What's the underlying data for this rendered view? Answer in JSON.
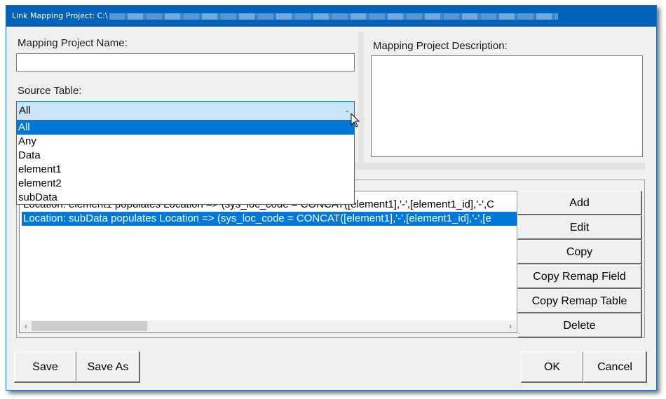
{
  "window": {
    "title": "Link Mapping Project: C:\\"
  },
  "form": {
    "project_name_label": "Mapping Project Name:",
    "project_name_value": "",
    "description_label": "Mapping Project Description:",
    "description_value": "",
    "source_table_label": "Source Table:",
    "source_table_selected": "All",
    "source_table_options": [
      "All",
      "Any",
      "Data",
      "element1",
      "element2",
      "subData"
    ]
  },
  "mappings": {
    "rows": [
      {
        "text": "Location: element1 populates Location => (sys_loc_code = CONCAT([element1],'-',[element1_id],'-',C",
        "selected": false,
        "visible_fragment": "T([element1],'-',[element1_id],'-',C"
      },
      {
        "text": "Location: subData populates Location => (sys_loc_code = CONCAT([element1],'-',[element1_id],'-',[e",
        "selected": true
      }
    ],
    "scroll_left_icon": "‹",
    "scroll_right_icon": "›"
  },
  "side_buttons": [
    "Add",
    "Edit",
    "Copy",
    "Copy Remap Field",
    "Copy Remap Table",
    "Delete"
  ],
  "footer": {
    "save": "Save",
    "save_as": "Save As",
    "ok": "OK",
    "cancel": "Cancel"
  }
}
